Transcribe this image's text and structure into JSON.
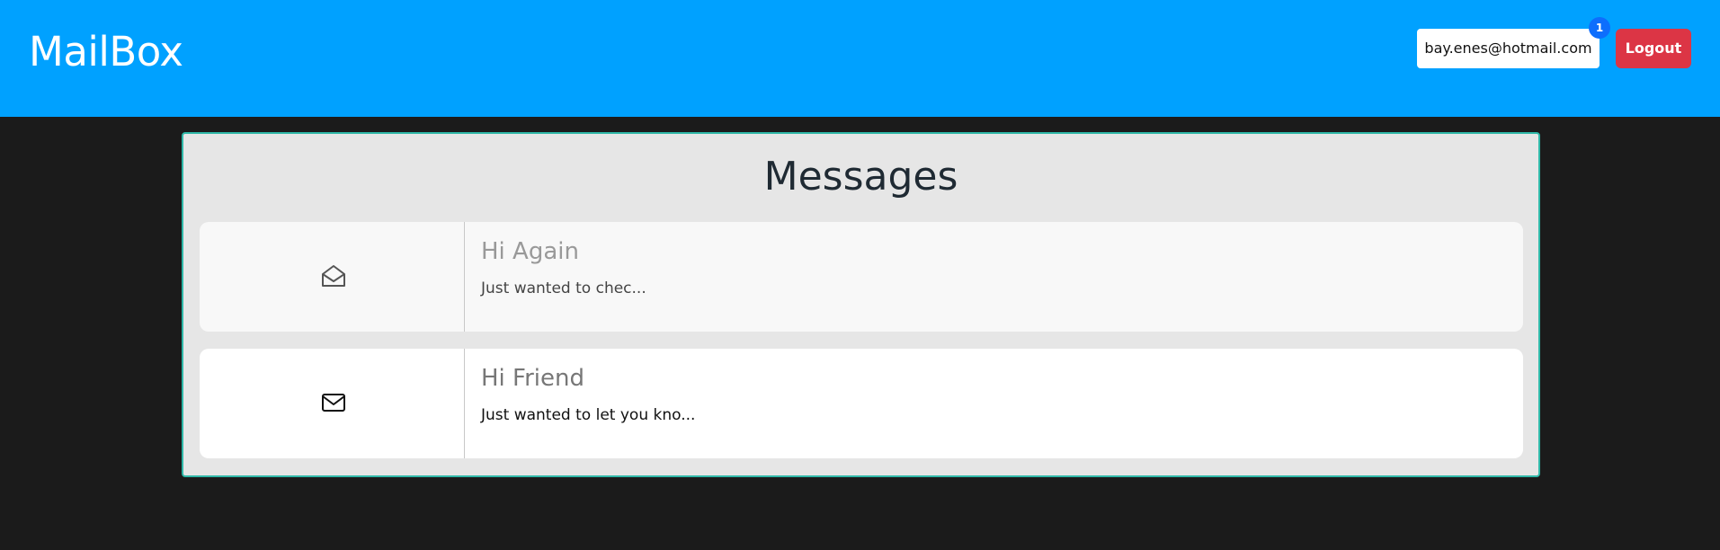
{
  "header": {
    "brand": "MailBox",
    "user_email": "bay.enes@hotmail.com",
    "notification_count": "1",
    "logout_label": "Logout"
  },
  "main": {
    "title": "Messages",
    "messages": [
      {
        "subject": "Hi Again",
        "preview": "Just wanted to chec...",
        "status": "read",
        "icon": "envelope-open-icon"
      },
      {
        "subject": "Hi Friend",
        "preview": "Just wanted to let you kno...",
        "status": "unread",
        "icon": "envelope-icon"
      }
    ]
  },
  "colors": {
    "navbar": "#00a1ff",
    "page_background": "#1b1b1b",
    "panel_background": "#e6e6e6",
    "panel_border": "#2fb8a8",
    "logout": "#dc3545",
    "badge": "#0d6efd"
  }
}
